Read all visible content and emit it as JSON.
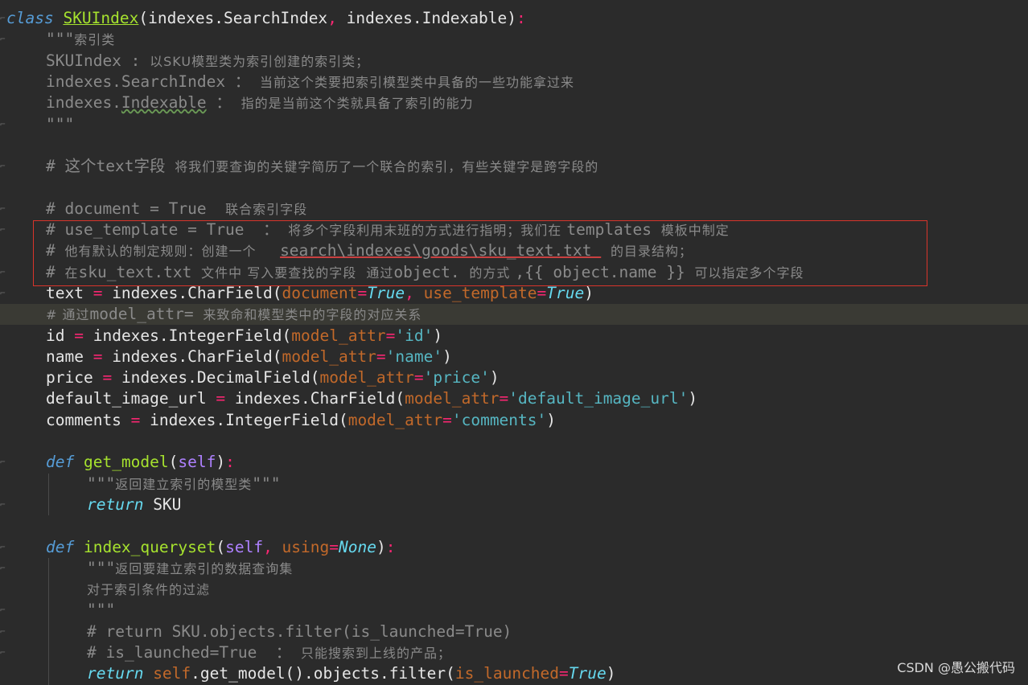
{
  "lines": [
    {
      "indent": 0,
      "hl": false,
      "tokens": [
        {
          "t": "class ",
          "c": "kw"
        },
        {
          "t": "SKUIndex",
          "c": "cls"
        },
        {
          "t": "(indexes.SearchIndex",
          "c": "par"
        },
        {
          "t": ", ",
          "c": "pun"
        },
        {
          "t": "indexes.Indexable)",
          "c": "par"
        },
        {
          "t": ":",
          "c": "pun"
        }
      ]
    },
    {
      "indent": 1,
      "tokens": [
        {
          "t": "\"\"\"",
          "c": "cm"
        },
        {
          "t": "索引类",
          "c": "cm cn"
        }
      ]
    },
    {
      "indent": 1,
      "tokens": [
        {
          "t": "SKUIndex : ",
          "c": "cm"
        },
        {
          "t": "以SKU模型类为索引创建的索引类；",
          "c": "cm cn"
        }
      ]
    },
    {
      "indent": 1,
      "tokens": [
        {
          "t": "indexes.SearchIndex ： ",
          "c": "cm"
        },
        {
          "t": "当前这个类要把索引模型类中具备的一些功能拿过来",
          "c": "cm cn"
        }
      ]
    },
    {
      "indent": 1,
      "tokens": [
        {
          "t": "indexes.",
          "c": "cm"
        },
        {
          "t": "Indexable",
          "c": "cm wave"
        },
        {
          "t": " ： ",
          "c": "cm"
        },
        {
          "t": "指的是当前这个类就具备了索引的能力",
          "c": "cm cn"
        }
      ]
    },
    {
      "indent": 1,
      "tokens": [
        {
          "t": "\"\"\"",
          "c": "cm"
        }
      ]
    },
    {
      "indent": 1,
      "tokens": []
    },
    {
      "indent": 1,
      "tokens": [
        {
          "t": "# 这个text字段 ",
          "c": "cm"
        },
        {
          "t": "将我们要查询的关键字简历了一个联合的索引，有些关键字是跨字段的",
          "c": "cm cn"
        }
      ]
    },
    {
      "indent": 1,
      "tokens": []
    },
    {
      "indent": 1,
      "tokens": [
        {
          "t": "# document = True  ",
          "c": "cm"
        },
        {
          "t": "联合索引字段",
          "c": "cm cn"
        }
      ]
    },
    {
      "indent": 1,
      "tokens": [
        {
          "t": "# use_template = True  ： ",
          "c": "cm"
        },
        {
          "t": "将多个字段利用末班的方式进行指明；我们在 ",
          "c": "cm cn"
        },
        {
          "t": "templates ",
          "c": "cm"
        },
        {
          "t": "模板中制定",
          "c": "cm cn"
        }
      ]
    },
    {
      "indent": 1,
      "tokens": [
        {
          "t": "# ",
          "c": "cm"
        },
        {
          "t": "他有默认的制定规则：创建一个 ",
          "c": "cm cn"
        },
        {
          "t": "  ",
          "c": "cm"
        },
        {
          "t": "search\\indexes\\goods\\sku_text.txt ",
          "c": "cm ul"
        },
        {
          "t": " ",
          "c": "cm"
        },
        {
          "t": "的目录结构；",
          "c": "cm cn"
        }
      ]
    },
    {
      "indent": 1,
      "tokens": [
        {
          "t": "# ",
          "c": "cm"
        },
        {
          "t": "在",
          "c": "cm cn"
        },
        {
          "t": "sku_text.txt ",
          "c": "cm"
        },
        {
          "t": "文件中 写入要查找的字段  通过",
          "c": "cm cn"
        },
        {
          "t": "object. ",
          "c": "cm"
        },
        {
          "t": "的方式 ",
          "c": "cm cn"
        },
        {
          "t": ",{{ object.name }} ",
          "c": "cm"
        },
        {
          "t": "可以指定多个字段",
          "c": "cm cn"
        }
      ]
    },
    {
      "indent": 1,
      "tokens": [
        {
          "t": "text ",
          "c": "par"
        },
        {
          "t": "=",
          "c": "pun"
        },
        {
          "t": " indexes.CharField(",
          "c": "par"
        },
        {
          "t": "document",
          "c": "arg"
        },
        {
          "t": "=",
          "c": "pun"
        },
        {
          "t": "True",
          "c": "con"
        },
        {
          "t": ", ",
          "c": "pun"
        },
        {
          "t": "use_template",
          "c": "arg"
        },
        {
          "t": "=",
          "c": "pun"
        },
        {
          "t": "True",
          "c": "con"
        },
        {
          "t": ")",
          "c": "par"
        }
      ]
    },
    {
      "indent": 1,
      "hl": true,
      "tokens": [
        {
          "t": "# 通过",
          "c": "cm cn"
        },
        {
          "t": "model_attr= ",
          "c": "cm"
        },
        {
          "t": "来致命和模型类中的字段的对应关系",
          "c": "cm cn"
        }
      ]
    },
    {
      "indent": 1,
      "tokens": [
        {
          "t": "id ",
          "c": "par"
        },
        {
          "t": "=",
          "c": "pun"
        },
        {
          "t": " indexes.IntegerField(",
          "c": "par"
        },
        {
          "t": "model_attr",
          "c": "arg"
        },
        {
          "t": "=",
          "c": "pun"
        },
        {
          "t": "'id'",
          "c": "str"
        },
        {
          "t": ")",
          "c": "par"
        }
      ]
    },
    {
      "indent": 1,
      "tokens": [
        {
          "t": "name ",
          "c": "par"
        },
        {
          "t": "=",
          "c": "pun"
        },
        {
          "t": " indexes.CharField(",
          "c": "par"
        },
        {
          "t": "model_attr",
          "c": "arg"
        },
        {
          "t": "=",
          "c": "pun"
        },
        {
          "t": "'name'",
          "c": "str"
        },
        {
          "t": ")",
          "c": "par"
        }
      ]
    },
    {
      "indent": 1,
      "tokens": [
        {
          "t": "price ",
          "c": "par"
        },
        {
          "t": "=",
          "c": "pun"
        },
        {
          "t": " indexes.DecimalField(",
          "c": "par"
        },
        {
          "t": "model_attr",
          "c": "arg"
        },
        {
          "t": "=",
          "c": "pun"
        },
        {
          "t": "'price'",
          "c": "str"
        },
        {
          "t": ")",
          "c": "par"
        }
      ]
    },
    {
      "indent": 1,
      "tokens": [
        {
          "t": "default_image_url ",
          "c": "par"
        },
        {
          "t": "=",
          "c": "pun"
        },
        {
          "t": " indexes.CharField(",
          "c": "par"
        },
        {
          "t": "model_attr",
          "c": "arg"
        },
        {
          "t": "=",
          "c": "pun"
        },
        {
          "t": "'default_image_url'",
          "c": "str"
        },
        {
          "t": ")",
          "c": "par"
        }
      ]
    },
    {
      "indent": 1,
      "tokens": [
        {
          "t": "comments ",
          "c": "par"
        },
        {
          "t": "=",
          "c": "pun"
        },
        {
          "t": " indexes.IntegerField(",
          "c": "par"
        },
        {
          "t": "model_attr",
          "c": "arg"
        },
        {
          "t": "=",
          "c": "pun"
        },
        {
          "t": "'comments'",
          "c": "str"
        },
        {
          "t": ")",
          "c": "par"
        }
      ]
    },
    {
      "indent": 1,
      "tokens": []
    },
    {
      "indent": 1,
      "tokens": [
        {
          "t": "def ",
          "c": "kw"
        },
        {
          "t": "get_model",
          "c": "fn"
        },
        {
          "t": "(",
          "c": "par"
        },
        {
          "t": "self",
          "c": "self"
        },
        {
          "t": ")",
          "c": "par"
        },
        {
          "t": ":",
          "c": "pun"
        }
      ]
    },
    {
      "indent": 2,
      "tokens": [
        {
          "t": "\"\"\"",
          "c": "cm"
        },
        {
          "t": "返回建立索引的模型类",
          "c": "cm cn"
        },
        {
          "t": "\"\"\"",
          "c": "cm"
        }
      ]
    },
    {
      "indent": 2,
      "tokens": [
        {
          "t": "return ",
          "c": "kw2"
        },
        {
          "t": "SKU",
          "c": "par"
        }
      ]
    },
    {
      "indent": 1,
      "tokens": []
    },
    {
      "indent": 1,
      "tokens": [
        {
          "t": "def ",
          "c": "kw"
        },
        {
          "t": "index_queryset",
          "c": "fn"
        },
        {
          "t": "(",
          "c": "par"
        },
        {
          "t": "self",
          "c": "self"
        },
        {
          "t": ", ",
          "c": "pun"
        },
        {
          "t": "using",
          "c": "arg"
        },
        {
          "t": "=",
          "c": "pun"
        },
        {
          "t": "None",
          "c": "con"
        },
        {
          "t": ")",
          "c": "par"
        },
        {
          "t": ":",
          "c": "pun"
        }
      ]
    },
    {
      "indent": 2,
      "tokens": [
        {
          "t": "\"\"\"",
          "c": "cm"
        },
        {
          "t": "返回要建立索引的数据查询集",
          "c": "cm cn"
        }
      ]
    },
    {
      "indent": 2,
      "tokens": [
        {
          "t": "对于索引条件的过滤",
          "c": "cm cn"
        }
      ]
    },
    {
      "indent": 2,
      "tokens": [
        {
          "t": "\"\"\"",
          "c": "cm"
        }
      ]
    },
    {
      "indent": 2,
      "tokens": [
        {
          "t": "# return SKU.objects.filter(is_launched=True)",
          "c": "cm"
        }
      ]
    },
    {
      "indent": 2,
      "tokens": [
        {
          "t": "# is_launched=True  ： ",
          "c": "cm"
        },
        {
          "t": "只能搜索到上线的产品；",
          "c": "cm cn"
        }
      ]
    },
    {
      "indent": 2,
      "tokens": [
        {
          "t": "return ",
          "c": "kw2"
        },
        {
          "t": "self",
          "c": "slf2"
        },
        {
          "t": ".get_model().objects.filter(",
          "c": "par"
        },
        {
          "t": "is_launched",
          "c": "arg"
        },
        {
          "t": "=",
          "c": "pun"
        },
        {
          "t": "True",
          "c": "con"
        },
        {
          "t": ")",
          "c": "par"
        }
      ]
    }
  ],
  "watermark": "CSDN @愚公搬代码"
}
